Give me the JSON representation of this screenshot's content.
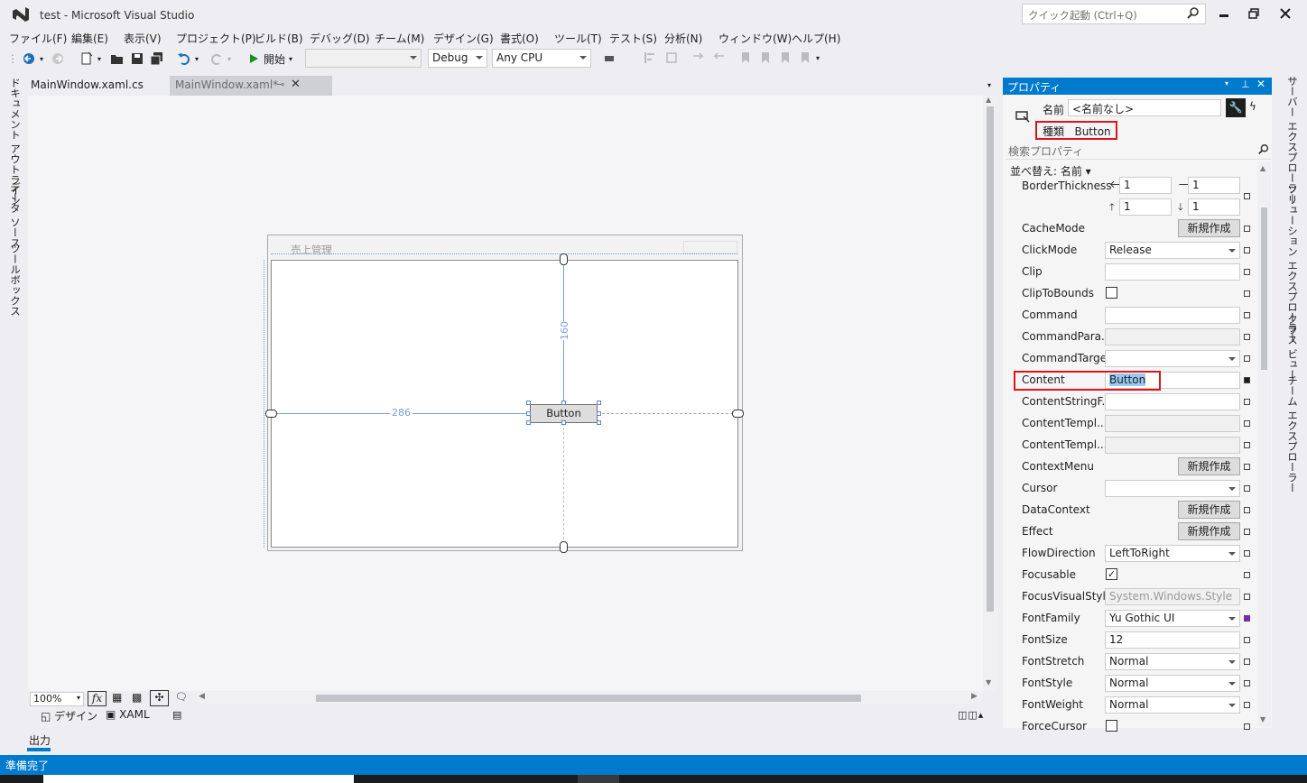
{
  "window": {
    "title": "test - Microsoft Visual Studio",
    "quick_launch": "クイック起動 (Ctrl+Q)"
  },
  "menu": [
    "ファイル(F)",
    "編集(E)",
    "表示(V)",
    "プロジェクト(P)",
    "ビルド(B)",
    "デバッグ(D)",
    "チーム(M)",
    "デザイン(G)",
    "書式(O)",
    "ツール(T)",
    "テスト(S)",
    "分析(N)",
    "ウィンドウ(W)",
    "ヘルプ(H)"
  ],
  "toolbar": {
    "start_label": "開始",
    "config": "Debug",
    "platform": "Any CPU"
  },
  "left_tabs": [
    "ドキュメント アウトライン",
    "データ ソース",
    "ツールボックス"
  ],
  "doc_tabs": [
    {
      "label": "MainWindow.xaml.cs"
    },
    {
      "label": "MainWindow.xaml*"
    }
  ],
  "designer": {
    "window_title": "売上管理",
    "button_content": "Button",
    "margin_top": "160",
    "margin_left": "286",
    "zoom": "100%",
    "view_design": "デザイン",
    "view_xaml": "XAML"
  },
  "output_label": "出力",
  "status": "準備完了",
  "properties": {
    "title": "プロパティ",
    "name_label": "名前",
    "name_value": "<名前なし>",
    "type_label": "種類",
    "type_value": "Button",
    "search_placeholder": "検索プロパティ",
    "sort_label": "並べ替え: 名前",
    "border_thickness": {
      "name": "BorderThickness",
      "left": "1",
      "right": "1",
      "top": "1",
      "bottom": "1"
    },
    "rows": [
      {
        "name": "CacheMode",
        "kind": "new",
        "value": "新規作成"
      },
      {
        "name": "ClickMode",
        "kind": "combo",
        "value": "Release"
      },
      {
        "name": "Clip",
        "kind": "text",
        "value": ""
      },
      {
        "name": "ClipToBounds",
        "kind": "check",
        "value": ""
      },
      {
        "name": "Command",
        "kind": "text",
        "value": ""
      },
      {
        "name": "CommandPara...",
        "kind": "disabled",
        "value": ""
      },
      {
        "name": "CommandTarget",
        "kind": "combo",
        "value": ""
      },
      {
        "name": "Content",
        "kind": "text",
        "value": "Button"
      },
      {
        "name": "ContentStringF...",
        "kind": "text",
        "value": ""
      },
      {
        "name": "ContentTempl...",
        "kind": "disabled",
        "value": ""
      },
      {
        "name": "ContentTempl...",
        "kind": "disabled",
        "value": ""
      },
      {
        "name": "ContextMenu",
        "kind": "new",
        "value": "新規作成"
      },
      {
        "name": "Cursor",
        "kind": "combo",
        "value": ""
      },
      {
        "name": "DataContext",
        "kind": "new",
        "value": "新規作成"
      },
      {
        "name": "Effect",
        "kind": "new",
        "value": "新規作成"
      },
      {
        "name": "FlowDirection",
        "kind": "combo",
        "value": "LeftToRight"
      },
      {
        "name": "Focusable",
        "kind": "checked",
        "value": "✓"
      },
      {
        "name": "FocusVisualStyle",
        "kind": "disabled",
        "value": "System.Windows.Style"
      },
      {
        "name": "FontFamily",
        "kind": "combo",
        "value": "Yu Gothic UI"
      },
      {
        "name": "FontSize",
        "kind": "text",
        "value": "12"
      },
      {
        "name": "FontStretch",
        "kind": "combo",
        "value": "Normal"
      },
      {
        "name": "FontStyle",
        "kind": "combo",
        "value": "Normal"
      },
      {
        "name": "FontWeight",
        "kind": "combo",
        "value": "Normal"
      },
      {
        "name": "ForceCursor",
        "kind": "check",
        "value": ""
      }
    ]
  },
  "right_tabs": [
    "サーバー エクスプローラー",
    "ソリューション エクスプローラー",
    "クラス ビュー",
    "チーム エクスプローラー"
  ],
  "colors": {
    "accent": "#007acc",
    "highlight": "#e0131a",
    "margin_line": "#7c9fd6"
  }
}
